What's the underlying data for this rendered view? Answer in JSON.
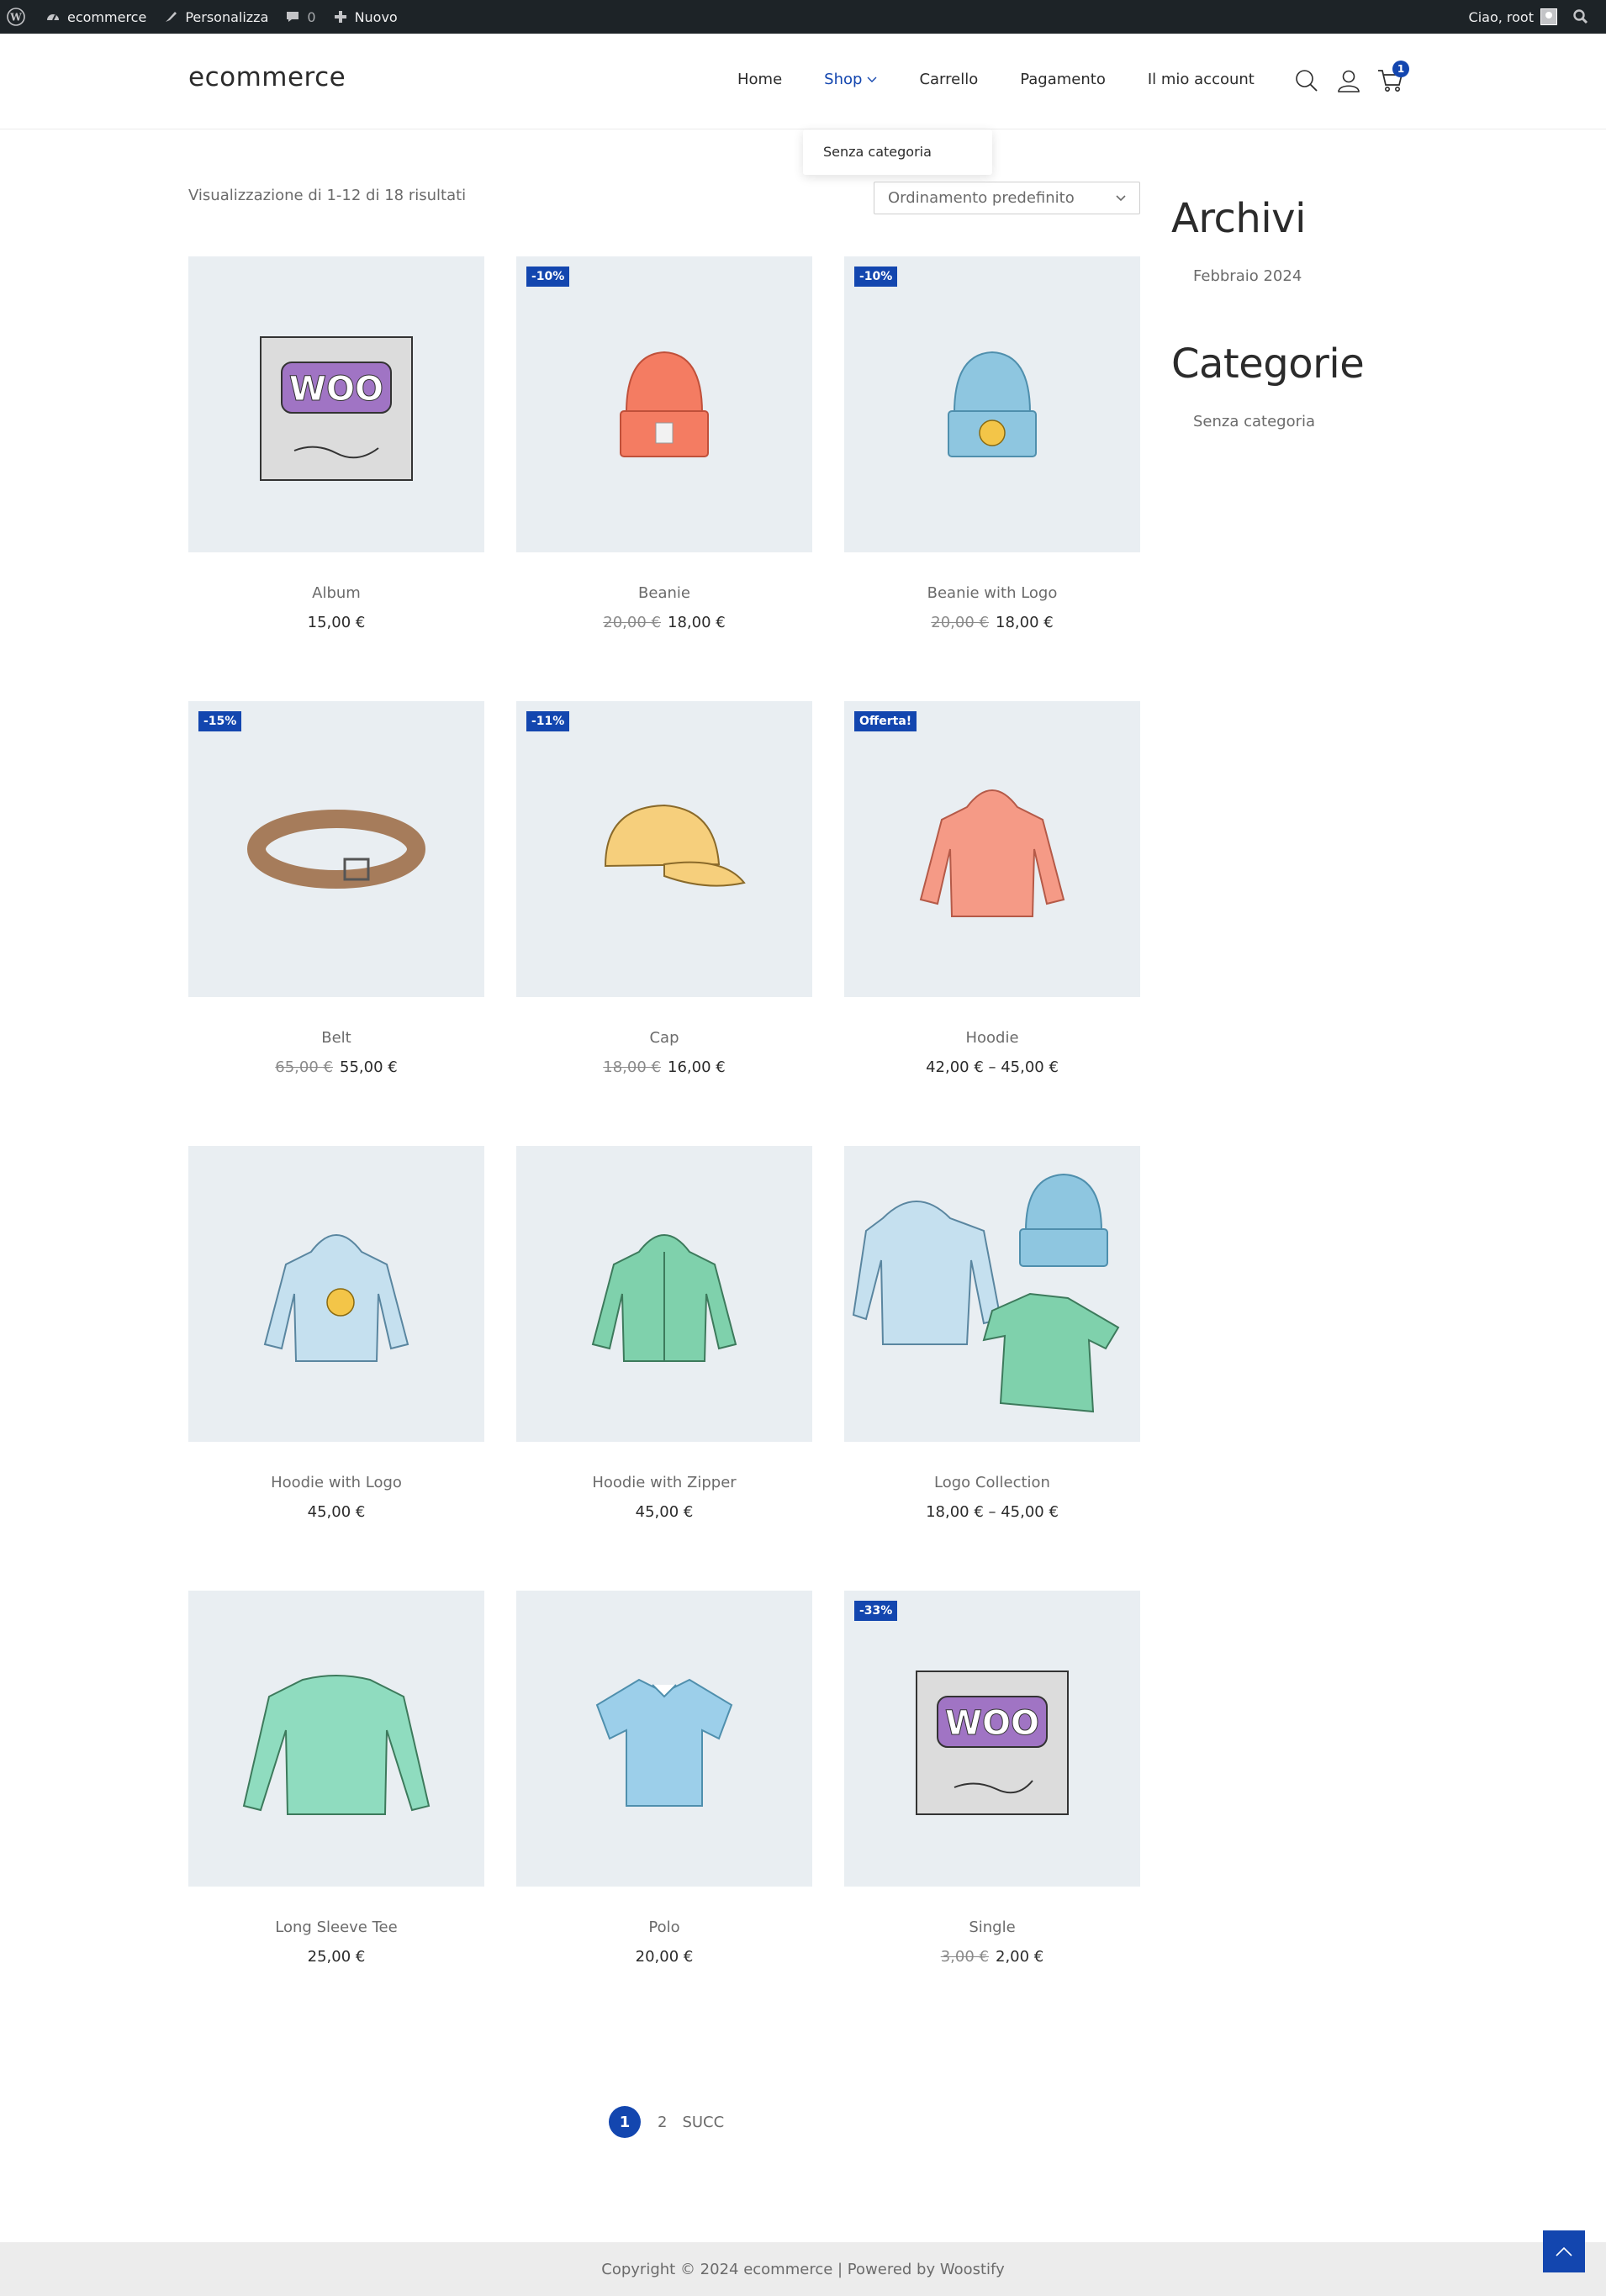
{
  "adminbar": {
    "site_name": "ecommerce",
    "customize": "Personalizza",
    "comments_count": "0",
    "new": "Nuovo",
    "greeting": "Ciao, root"
  },
  "header": {
    "logo": "ecommerce",
    "nav": [
      "Home",
      "Shop",
      "Carrello",
      "Pagamento",
      "Il mio account"
    ],
    "cart_count": "1",
    "dropdown_item": "Senza categoria"
  },
  "shop": {
    "result_count": "Visualizzazione di 1-12 di 18 risultati",
    "ordering": "Ordinamento predefinito",
    "products": [
      {
        "name": "Album",
        "price": "15,00 €",
        "old_price": "",
        "badge": "",
        "art": "album"
      },
      {
        "name": "Beanie",
        "price": "18,00 €",
        "old_price": "20,00 €",
        "badge": "-10%",
        "art": "beanie"
      },
      {
        "name": "Beanie with Logo",
        "price": "18,00 €",
        "old_price": "20,00 €",
        "badge": "-10%",
        "art": "beanie-logo"
      },
      {
        "name": "Belt",
        "price": "55,00 €",
        "old_price": "65,00 €",
        "badge": "-15%",
        "art": "belt"
      },
      {
        "name": "Cap",
        "price": "16,00 €",
        "old_price": "18,00 €",
        "badge": "-11%",
        "art": "cap"
      },
      {
        "name": "Hoodie",
        "price": "42,00 € – 45,00 €",
        "old_price": "",
        "badge": "Offerta!",
        "art": "hoodie"
      },
      {
        "name": "Hoodie with Logo",
        "price": "45,00 €",
        "old_price": "",
        "badge": "",
        "art": "hoodie-logo"
      },
      {
        "name": "Hoodie with Zipper",
        "price": "45,00 €",
        "old_price": "",
        "badge": "",
        "art": "hoodie-zipper"
      },
      {
        "name": "Logo Collection",
        "price": "18,00 € – 45,00 €",
        "old_price": "",
        "badge": "",
        "art": "collection"
      },
      {
        "name": "Long Sleeve Tee",
        "price": "25,00 €",
        "old_price": "",
        "badge": "",
        "art": "longsleeve"
      },
      {
        "name": "Polo",
        "price": "20,00 €",
        "old_price": "",
        "badge": "",
        "art": "polo"
      },
      {
        "name": "Single",
        "price": "2,00 €",
        "old_price": "3,00 €",
        "badge": "-33%",
        "art": "single"
      }
    ]
  },
  "sidebar": {
    "archives_title": "Archivi",
    "archives_link": "Febbraio 2024",
    "categories_title": "Categorie",
    "categories_link": "Senza categoria"
  },
  "pagination": {
    "current": "1",
    "next_page": "2",
    "next_label": "SUCC"
  },
  "footer": {
    "copyright": "Copyright © 2024 ecommerce | Powered by Woostify"
  },
  "colors": {
    "accent": "#1346af",
    "adminbar": "#1d2327",
    "product_bg": "#e9eef2"
  }
}
